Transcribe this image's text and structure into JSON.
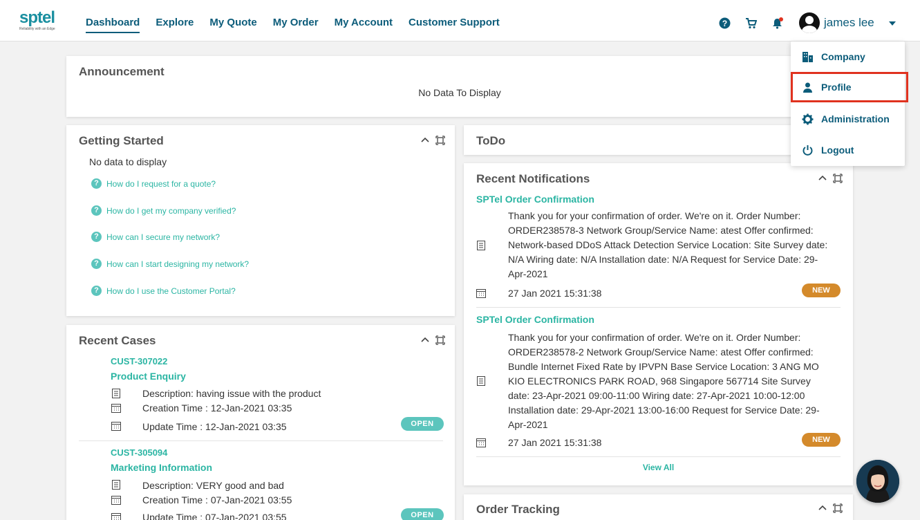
{
  "brand": {
    "logo_text": "sptel",
    "tagline": "Reliability with an Edge"
  },
  "nav": {
    "items": [
      {
        "label": "Dashboard"
      },
      {
        "label": "Explore"
      },
      {
        "label": "My Quote"
      },
      {
        "label": "My Order"
      },
      {
        "label": "My Account"
      },
      {
        "label": "Customer Support"
      }
    ],
    "active": "Dashboard"
  },
  "header": {
    "user_name": "james lee",
    "icons": [
      "help-icon",
      "cart-icon",
      "bell-icon"
    ]
  },
  "user_menu": {
    "items": [
      {
        "label": "Company",
        "icon": "building-icon"
      },
      {
        "label": "Profile",
        "icon": "person-icon"
      },
      {
        "label": "Administration",
        "icon": "gear-icon"
      },
      {
        "label": "Logout",
        "icon": "power-icon"
      }
    ],
    "highlighted": "Profile",
    "highlight_color": "#e0321f"
  },
  "announcement": {
    "title": "Announcement",
    "empty_text": "No Data To Display"
  },
  "getting_started": {
    "title": "Getting Started",
    "empty_text": "No data to display",
    "links": [
      "How do I request for a quote?",
      "How do I get my company verified?",
      "How can I secure my network?",
      "How can I start designing my network?",
      "How do I use the Customer Portal?"
    ]
  },
  "todo": {
    "title": "ToDo"
  },
  "recent_cases": {
    "title": "Recent Cases",
    "cases": [
      {
        "id": "CUST-307022",
        "type": "Product Enquiry",
        "description": "Description: having issue with the product",
        "creation": "Creation Time : 12-Jan-2021 03:35",
        "update": "Update Time : 12-Jan-2021 03:35",
        "status": "OPEN"
      },
      {
        "id": "CUST-305094",
        "type": "Marketing Information",
        "description": "Description: VERY good and bad",
        "creation": "Creation Time : 07-Jan-2021 03:55",
        "update": "Update Time : 07-Jan-2021 03:55",
        "status": "OPEN"
      }
    ]
  },
  "recent_notifications": {
    "title": "Recent Notifications",
    "items": [
      {
        "title": "SPTel Order Confirmation",
        "body": "Thank you for your confirmation of order. We're on it. Order Number: ORDER238578-3 Network Group/Service Name: atest Offer confirmed: Network-based DDoS Attack Detection Service Location: Site Survey date: N/A Wiring date: N/A Installation date: N/A Request for Service Date: 29-Apr-2021",
        "timestamp": "27 Jan 2021 15:31:38",
        "badge": "NEW"
      },
      {
        "title": "SPTel Order Confirmation",
        "body": "Thank you for your confirmation of order. We're on it. Order Number: ORDER238578-2 Network Group/Service Name: atest Offer confirmed: Bundle Internet Fixed Rate by IPVPN Base Service Location: 3 ANG MO KIO ELECTRONICS PARK ROAD, 968 Singapore 567714 Site Survey date: 23-Apr-2021 09:00-11:00 Wiring date: 27-Apr-2021 10:00-12:00 Installation date: 29-Apr-2021 13:00-16:00 Request for Service Date: 29-Apr-2021",
        "timestamp": "27 Jan 2021 15:31:38",
        "badge": "NEW"
      }
    ],
    "view_all": "View All"
  },
  "order_tracking": {
    "title": "Order Tracking"
  },
  "colors": {
    "primary": "#0c5c7a",
    "teal": "#2bb5a3",
    "new_badge": "#d48a2b",
    "open_badge": "#5cc5bd"
  }
}
